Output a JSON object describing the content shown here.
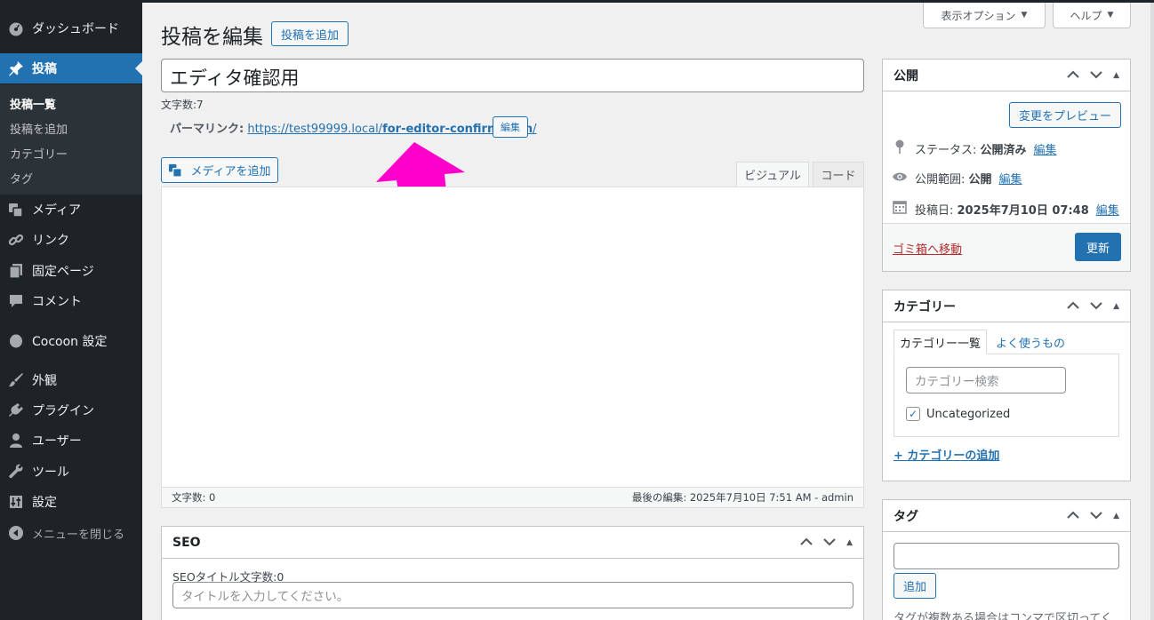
{
  "sidebar": {
    "dashboard": "ダッシュボード",
    "posts": "投稿",
    "submenu": [
      "投稿一覧",
      "投稿を追加",
      "カテゴリー",
      "タグ"
    ],
    "media": "メディア",
    "links": "リンク",
    "pages": "固定ページ",
    "comments": "コメント",
    "cocoon": "Cocoon 設定",
    "appearance": "外観",
    "plugins": "プラグイン",
    "users": "ユーザー",
    "tools": "ツール",
    "settings": "設定",
    "collapse": "メニューを閉じる"
  },
  "screen_meta": {
    "options_label": "表示オプション",
    "help_label": "ヘルプ"
  },
  "heading": {
    "title": "投稿を編集",
    "add_new": "投稿を追加"
  },
  "post": {
    "title": "エディタ確認用",
    "char_count": "文字数:7",
    "permalink_label": "パーマリンク:",
    "permalink_base": "https://test99999.local/",
    "permalink_slug": "for-editor-confirmation",
    "permalink_trail": "/",
    "permalink_edit": "編集"
  },
  "editor": {
    "add_media": "メディアを追加",
    "tab_visual": "ビジュアル",
    "tab_code": "コード",
    "word_count": "文字数: 0",
    "last_edit": "最後の編集: 2025年7月10日 7:51 AM - admin"
  },
  "publish_box": {
    "title": "公開",
    "preview_button": "変更をプレビュー",
    "status_label": "ステータス: ",
    "status_value": "公開済み",
    "visibility_label": "公開範囲: ",
    "visibility_value": "公開",
    "date_label": "投稿日: ",
    "date_value": "2025年7月10日 07:48",
    "edit": "編集",
    "trash": "ゴミ箱へ移動",
    "update": "更新"
  },
  "category_box": {
    "title": "カテゴリー",
    "tab_all": "カテゴリー一覧",
    "tab_popular": "よく使うもの",
    "search_placeholder": "カテゴリー検索",
    "items": [
      {
        "label": "Uncategorized",
        "checked": true
      }
    ],
    "add_link": "+ カテゴリーの追加"
  },
  "tag_box": {
    "title": "タグ",
    "add_button": "追加",
    "hint": "タグが複数ある場合はコンマで区切ってく"
  },
  "seo_box": {
    "title": "SEO",
    "title_count_label": "SEOタイトル文字数:0",
    "title_placeholder": "タイトルを入力してください。"
  },
  "colors": {
    "sidebar_bg": "#1d2327",
    "accent": "#2271b1",
    "arrow": "#ff00cc",
    "trash": "#b32d2e"
  }
}
